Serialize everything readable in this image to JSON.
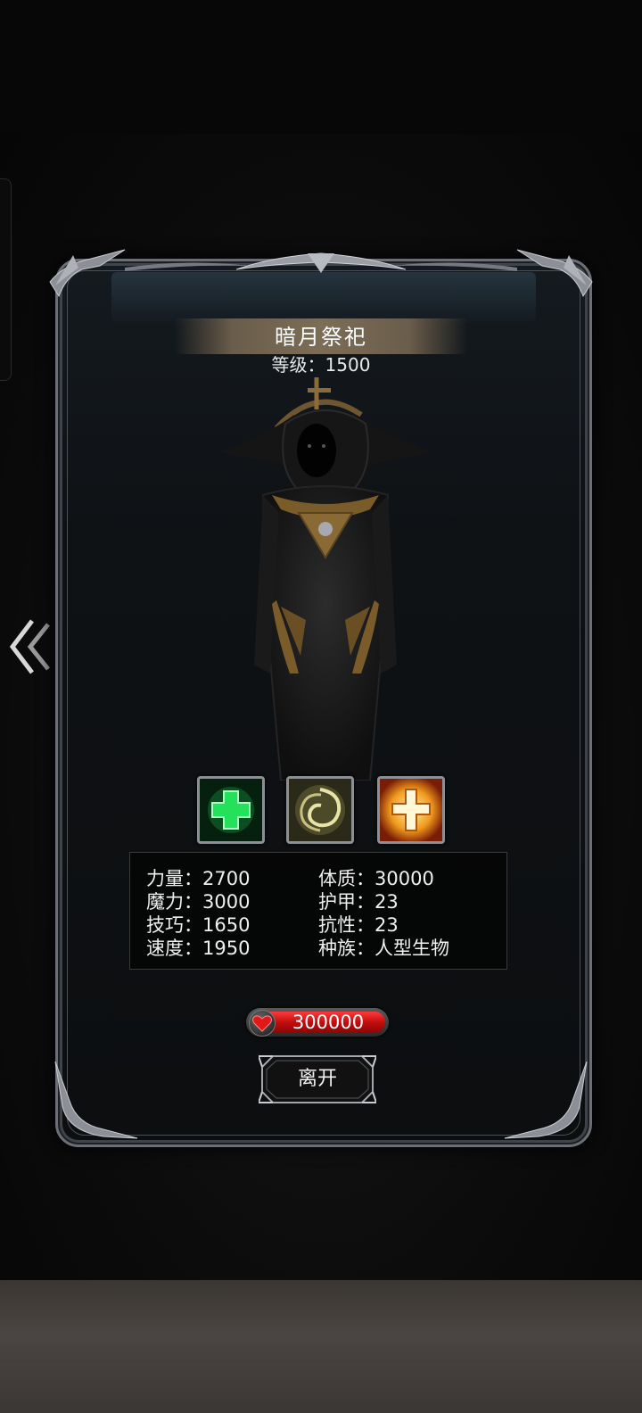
{
  "monster": {
    "name": "暗月祭祀",
    "level_label": "等级",
    "separator": "：",
    "level_value": "1500"
  },
  "skills": [
    {
      "icon": "green-cross-heal-icon"
    },
    {
      "icon": "swirl-vortex-icon"
    },
    {
      "icon": "golden-cross-shield-icon"
    }
  ],
  "stats": {
    "left": [
      {
        "label": "力量",
        "value": "2700"
      },
      {
        "label": "魔力",
        "value": "3000"
      },
      {
        "label": "技巧",
        "value": "1650"
      },
      {
        "label": "速度",
        "value": "1950"
      }
    ],
    "right": [
      {
        "label": "体质",
        "value": "30000"
      },
      {
        "label": "护甲",
        "value": "23"
      },
      {
        "label": "抗性",
        "value": "23"
      },
      {
        "label": "种族",
        "value": "人型生物"
      }
    ]
  },
  "hp": {
    "value": "300000",
    "fill_fraction": 1.0,
    "color": "#d41313"
  },
  "buttons": {
    "leave_label": "离开"
  },
  "colors": {
    "banner": "#7c6d56",
    "accent_gold": "#b08a3a"
  }
}
